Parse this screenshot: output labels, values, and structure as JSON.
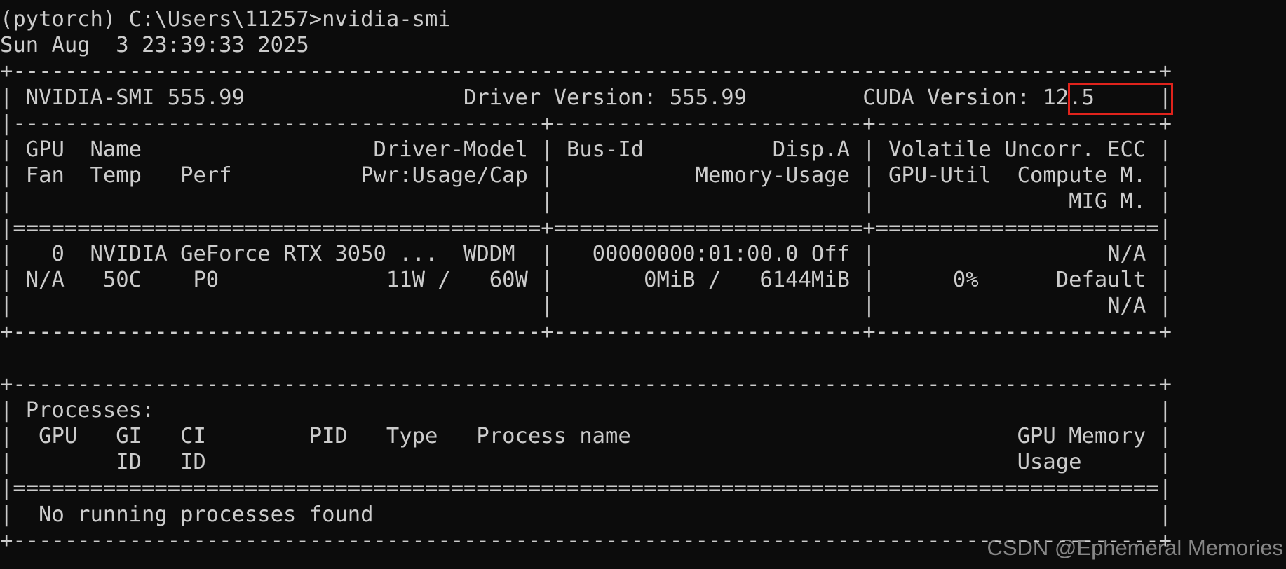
{
  "terminal": {
    "lines": [
      "(pytorch) C:\\Users\\11257>nvidia-smi",
      "Sun Aug  3 23:39:33 2025",
      "+-----------------------------------------------------------------------------------------+",
      "| NVIDIA-SMI 555.99                 Driver Version: 555.99         CUDA Version: 12.5     |",
      "|-----------------------------------------+------------------------+----------------------+",
      "| GPU  Name                  Driver-Model | Bus-Id          Disp.A | Volatile Uncorr. ECC |",
      "| Fan  Temp   Perf          Pwr:Usage/Cap |           Memory-Usage | GPU-Util  Compute M. |",
      "|                                         |                        |               MIG M. |",
      "|=========================================+========================+======================|",
      "|   0  NVIDIA GeForce RTX 3050 ...  WDDM  |   00000000:01:00.0 Off |                  N/A |",
      "| N/A   50C    P0             11W /   60W |       0MiB /   6144MiB |      0%      Default |",
      "|                                         |                        |                  N/A |",
      "+-----------------------------------------+------------------------+----------------------+",
      "",
      "+-----------------------------------------------------------------------------------------+",
      "| Processes:                                                                              |",
      "|  GPU   GI   CI        PID   Type   Process name                              GPU Memory |",
      "|        ID   ID                                                               Usage      |",
      "|=========================================================================================|",
      "|  No running processes found                                                             |",
      "+-----------------------------------------------------------------------------------------+"
    ]
  },
  "highlight": {
    "label": "CUDA version highlight",
    "color": "#e0231c"
  },
  "watermark": {
    "text": "CSDN @Ephemeral Memories"
  },
  "colors": {
    "background": "#0c0c0c",
    "text": "#cccccc"
  }
}
